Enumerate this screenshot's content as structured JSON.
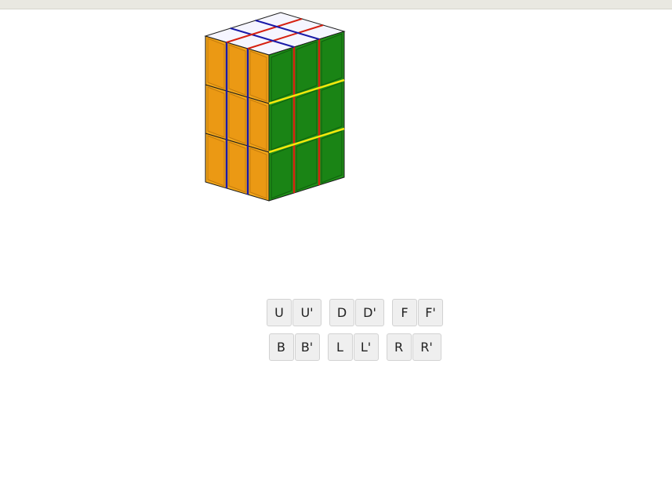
{
  "cube": {
    "face_colors": {
      "top": "#f4f4ff",
      "left": "#f0a51a",
      "right": "#1f8f18",
      "edge_blue": "#1a1aa8",
      "edge_red": "#d62010",
      "edge_yellow": "#f5e80c"
    }
  },
  "moves": {
    "row1": [
      {
        "labels": [
          "U",
          "U'"
        ]
      },
      {
        "labels": [
          "D",
          "D'"
        ]
      },
      {
        "labels": [
          "F",
          "F'"
        ]
      }
    ],
    "row2": [
      {
        "labels": [
          "B",
          "B'"
        ]
      },
      {
        "labels": [
          "L",
          "L'"
        ]
      },
      {
        "labels": [
          "R",
          "R'"
        ]
      }
    ]
  }
}
